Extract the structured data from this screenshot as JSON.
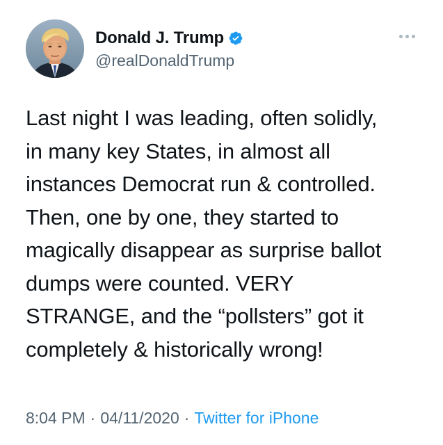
{
  "author": {
    "display_name": "Donald J. Trump",
    "handle": "@realDonaldTrump",
    "verified": true,
    "verified_color": "#1d9bf0"
  },
  "tweet": {
    "lines": [
      "Last night I was leading, often solidly,",
      "in many key States, in almost all",
      "instances Democrat run & controlled.",
      "Then, one by one, they started to",
      "magically disappear as surprise ballot",
      "dumps were counted. VERY",
      "STRANGE, and the “pollsters” got it",
      "completely & historically wrong!"
    ]
  },
  "meta": {
    "time": "8:04 PM",
    "separator": "·",
    "date": "04/11/2020",
    "source": "Twitter for iPhone"
  },
  "icons": {
    "more": "more-options-icon",
    "verified": "verified-badge-icon"
  }
}
